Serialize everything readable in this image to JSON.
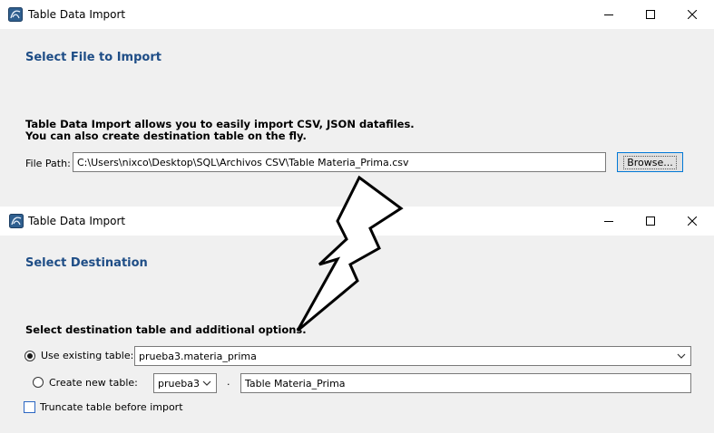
{
  "window1": {
    "title": "Table Data Import",
    "heading": "Select File to Import",
    "description_line1": "Table Data Import allows you to easily import CSV, JSON datafiles.",
    "description_line2": "You can also create destination table on the fly.",
    "file_path_label": "File Path:",
    "file_path_value": "C:\\Users\\nixco\\Desktop\\SQL\\Archivos CSV\\Table Materia_Prima.csv",
    "browse_label": "Browse..."
  },
  "window2": {
    "title": "Table Data Import",
    "heading": "Select Destination",
    "instruction": "Select destination table and additional options.",
    "use_existing_label": "Use existing table:",
    "use_existing_selected": true,
    "existing_table_value": "prueba3.materia_prima",
    "create_new_label": "Create new table:",
    "schema_value": "prueba3",
    "separator": ".",
    "new_table_name": "Table Materia_Prima",
    "truncate_label": "Truncate table before import",
    "truncate_checked": false
  },
  "colors": {
    "heading": "#1e4d86",
    "focus": "#0078d7"
  },
  "icons": [
    "mysql-workbench-icon",
    "minimize-icon",
    "maximize-icon",
    "close-icon",
    "chevron-down-icon",
    "lightning-bolt-icon"
  ]
}
